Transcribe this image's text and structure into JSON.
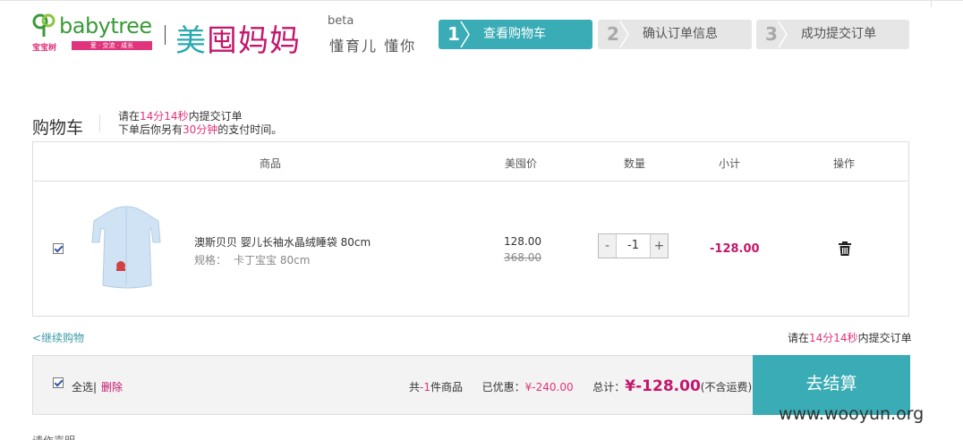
{
  "header": {
    "logo_word_baby": "baby",
    "logo_word_tree": "tree",
    "logo_cn": "宝宝树",
    "logo_slogan": "爱 · 交流 · 成长",
    "brand_part1": "美",
    "brand_part2": "囤",
    "brand_part3": "妈妈",
    "beta": "beta",
    "slogan": "懂育儿 懂你"
  },
  "steps": [
    {
      "num": "1",
      "label": "查看购物车",
      "active": true
    },
    {
      "num": "2",
      "label": "确认订单信息",
      "active": false
    },
    {
      "num": "3",
      "label": "成功提交订单",
      "active": false
    }
  ],
  "cart": {
    "title": "购物车",
    "notice_line1_pre": "请在",
    "notice_line1_time": "14分14秒",
    "notice_line1_post": "内提交订单",
    "notice_line2_pre": "下单后你另有",
    "notice_line2_time": "30分钟",
    "notice_line2_post": "的支付时间。"
  },
  "table": {
    "headers": {
      "product": "商品",
      "price": "美囤价",
      "qty": "数量",
      "subtotal": "小计",
      "op": "操作"
    },
    "item": {
      "name": "澳斯贝贝 婴儿长袖水晶绒睡袋 80cm",
      "spec_label": "规格：",
      "spec_value": "卡丁宝宝   80cm",
      "price_now": "128.00",
      "price_old": "368.00",
      "qty_minus": "-",
      "qty": "-1",
      "qty_plus": "+",
      "subtotal": "-128.00"
    }
  },
  "below": {
    "continue": "<继续购物",
    "notice_pre": "请在",
    "notice_time": "14分14秒",
    "notice_post": "内提交订单"
  },
  "bar": {
    "select_all": "全选|",
    "delete": "删除",
    "count_pre": "共",
    "count": "-1",
    "count_post": "件商品",
    "discount_label": "已优惠：",
    "discount": "¥-240.00",
    "total_label": "总计：",
    "total": "¥-128.00",
    "shipping_note": "(不含运费)",
    "checkout": "去结算"
  },
  "partial_text": "请作声明",
  "watermark": "www.wooyun.org",
  "colors": {
    "teal": "#3aacb5",
    "magenta": "#c4166c",
    "pink": "#e0347c",
    "green": "#3a9a3a"
  }
}
